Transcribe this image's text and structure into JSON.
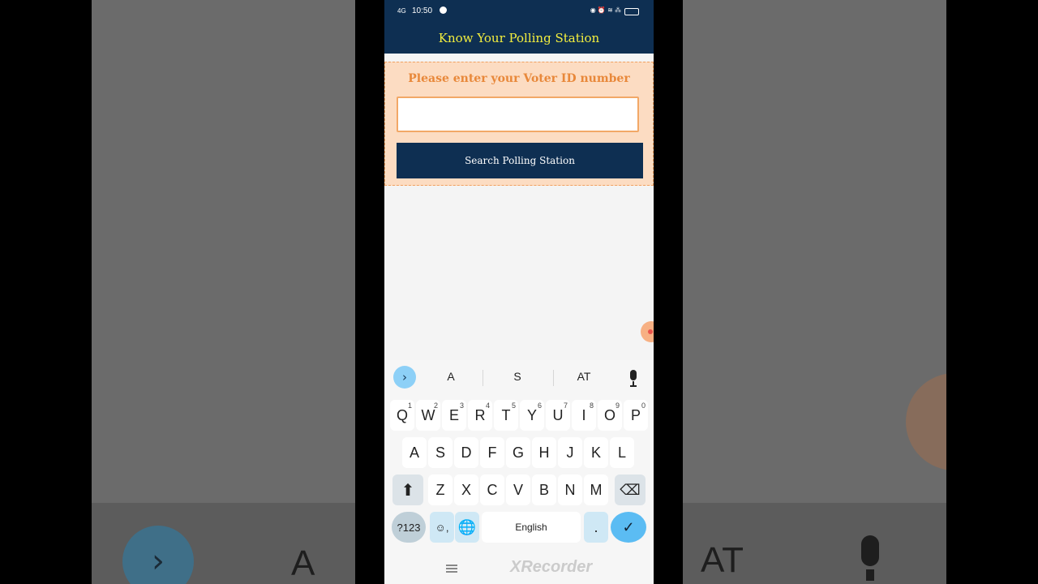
{
  "status": {
    "time": "10:50",
    "signal": "4G",
    "right": "◉ ⏰ ≋ ⁂"
  },
  "header": {
    "title": "Know Your Polling Station"
  },
  "form": {
    "label": "Please enter your Voter ID number",
    "input_value": "",
    "button": "Search Polling Station"
  },
  "keyboard": {
    "suggestions": [
      "A",
      "S",
      "AT"
    ],
    "row1": [
      {
        "k": "Q",
        "n": "1"
      },
      {
        "k": "W",
        "n": "2"
      },
      {
        "k": "E",
        "n": "3"
      },
      {
        "k": "R",
        "n": "4"
      },
      {
        "k": "T",
        "n": "5"
      },
      {
        "k": "Y",
        "n": "6"
      },
      {
        "k": "U",
        "n": "7"
      },
      {
        "k": "I",
        "n": "8"
      },
      {
        "k": "O",
        "n": "9"
      },
      {
        "k": "P",
        "n": "0"
      }
    ],
    "row2": [
      "A",
      "S",
      "D",
      "F",
      "G",
      "H",
      "J",
      "K",
      "L"
    ],
    "row3": [
      "Z",
      "X",
      "C",
      "V",
      "B",
      "N",
      "M"
    ],
    "sym": "?123",
    "emoji_comma": "☺,",
    "space": "English",
    "period": ".",
    "shift": "⬆",
    "backspace": "⌫",
    "enter": "✓"
  },
  "watermark": "XRecorder",
  "background": {
    "chevron": "›",
    "letters": [
      "A",
      "AT"
    ]
  }
}
